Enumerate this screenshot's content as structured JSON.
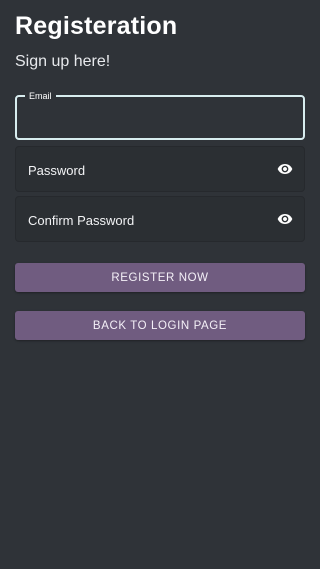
{
  "header": {
    "title": "Registeration",
    "subtitle": "Sign up here!"
  },
  "form": {
    "email": {
      "label": "Email",
      "value": ""
    },
    "password": {
      "placeholder": "Password",
      "icon": "eye-icon"
    },
    "confirm_password": {
      "placeholder": "Confirm Password",
      "icon": "eye-icon"
    }
  },
  "buttons": {
    "register_label": "REGISTER NOW",
    "back_label": "BACK TO LOGIN PAGE"
  },
  "colors": {
    "background": "#2f3338",
    "accent_button": "#705c80",
    "focused_border": "#d8edef"
  }
}
